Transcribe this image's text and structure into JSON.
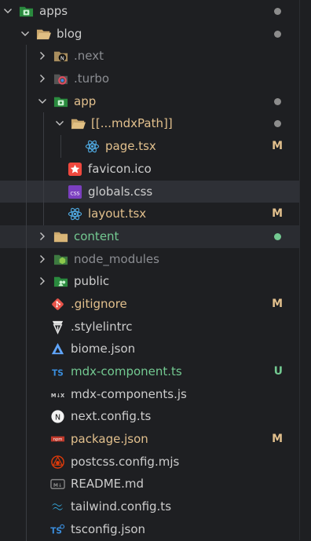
{
  "colors": {
    "default": "#cccccc",
    "modified": "#e2c08d",
    "untracked": "#73c991",
    "ignored": "#8b8d92",
    "dot_default": "#8c8c8c",
    "dot_untracked": "#73c991"
  },
  "rows": [
    {
      "label": "apps",
      "kind": "folder-open",
      "icon": "apps-folder-icon",
      "color": "#cccccc",
      "dot": "default"
    },
    {
      "label": "blog",
      "kind": "folder-open",
      "icon": "folder-open-icon",
      "color": "#cccccc",
      "dot": "default"
    },
    {
      "label": ".next",
      "kind": "folder-closed",
      "icon": "next-folder-icon",
      "color": "#8b8d92"
    },
    {
      "label": ".turbo",
      "kind": "folder-closed",
      "icon": "turbo-folder-icon",
      "color": "#8b8d92"
    },
    {
      "label": "app",
      "kind": "folder-open",
      "icon": "app-folder-icon",
      "color": "#e2c08d",
      "dot": "default"
    },
    {
      "label": "[[...mdxPath]]",
      "kind": "folder-open",
      "icon": "folder-open-icon",
      "color": "#e2c08d",
      "dot": "default"
    },
    {
      "label": "page.tsx",
      "kind": "file",
      "icon": "react-icon",
      "color": "#e2c08d",
      "status": "M"
    },
    {
      "label": "favicon.ico",
      "kind": "file",
      "icon": "favicon-icon",
      "color": "#cccccc"
    },
    {
      "label": "globals.css",
      "kind": "file",
      "icon": "css-icon",
      "color": "#cccccc"
    },
    {
      "label": "layout.tsx",
      "kind": "file",
      "icon": "react-icon",
      "color": "#e2c08d",
      "status": "M"
    },
    {
      "label": "content",
      "kind": "folder-closed",
      "icon": "folder-icon",
      "color": "#73c991",
      "dot": "untracked"
    },
    {
      "label": "node_modules",
      "kind": "folder-closed",
      "icon": "node-folder-icon",
      "color": "#8b8d92"
    },
    {
      "label": "public",
      "kind": "folder-closed",
      "icon": "public-folder-icon",
      "color": "#cccccc"
    },
    {
      "label": ".gitignore",
      "kind": "file",
      "icon": "git-icon",
      "color": "#e2c08d",
      "status": "M"
    },
    {
      "label": ".stylelintrc",
      "kind": "file",
      "icon": "stylelint-icon",
      "color": "#cccccc"
    },
    {
      "label": "biome.json",
      "kind": "file",
      "icon": "biome-icon",
      "color": "#cccccc"
    },
    {
      "label": "mdx-component.ts",
      "kind": "file",
      "icon": "typescript-icon",
      "color": "#73c991",
      "status": "U"
    },
    {
      "label": "mdx-components.js",
      "kind": "file",
      "icon": "mdx-icon",
      "color": "#cccccc"
    },
    {
      "label": "next.config.ts",
      "kind": "file",
      "icon": "nextjs-icon",
      "color": "#cccccc"
    },
    {
      "label": "package.json",
      "kind": "file",
      "icon": "npm-icon",
      "color": "#e2c08d",
      "status": "M"
    },
    {
      "label": "postcss.config.mjs",
      "kind": "file",
      "icon": "postcss-icon",
      "color": "#cccccc"
    },
    {
      "label": "README.md",
      "kind": "file",
      "icon": "markdown-icon",
      "color": "#cccccc"
    },
    {
      "label": "tailwind.config.ts",
      "kind": "file",
      "icon": "tailwind-icon",
      "color": "#cccccc"
    },
    {
      "label": "tsconfig.json",
      "kind": "file",
      "icon": "tsconfig-icon",
      "color": "#cccccc"
    }
  ]
}
